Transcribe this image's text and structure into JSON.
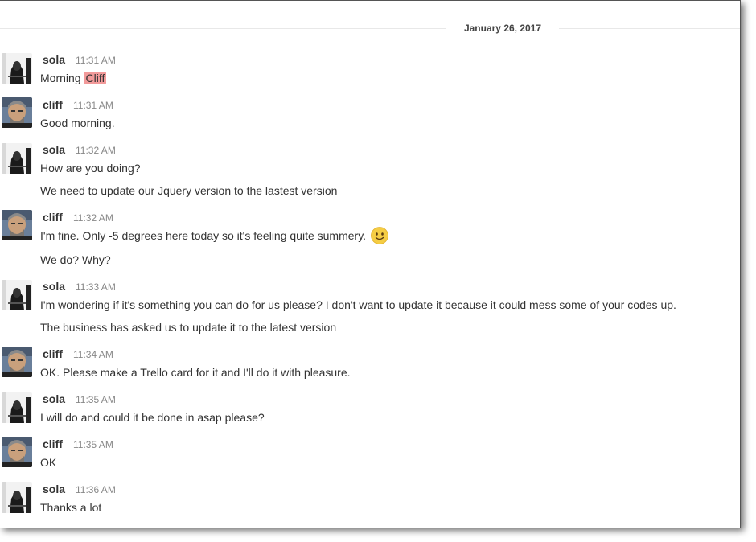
{
  "date_divider": "January 26, 2017",
  "messages": [
    {
      "user": "sola",
      "time": "11:31 AM",
      "lines": [
        {
          "pre": "Morning",
          "mention": "Cliff"
        }
      ]
    },
    {
      "user": "cliff",
      "time": "11:31 AM",
      "lines": [
        "Good morning."
      ]
    },
    {
      "user": "sola",
      "time": "11:32 AM",
      "lines": [
        "How are you doing?",
        "We need to update our Jquery version to the lastest version"
      ]
    },
    {
      "user": "cliff",
      "time": "11:32 AM",
      "lines": [
        "I'm fine. Only -5 degrees here today so it's feeling quite summery.",
        "We do? Why?"
      ]
    },
    {
      "user": "sola",
      "time": "11:33 AM",
      "lines": [
        "I'm wondering if it's something you can do for us please? I don't want to update it because it could mess some of your codes up.",
        "The business has asked us to update it to the latest version"
      ]
    },
    {
      "user": "cliff",
      "time": "11:34 AM",
      "lines": [
        "OK. Please make a Trello card for it and I'll do it with pleasure."
      ]
    },
    {
      "user": "sola",
      "time": "11:35 AM",
      "lines": [
        "I will do and could it be done in asap please?"
      ]
    },
    {
      "user": "cliff",
      "time": "11:35 AM",
      "lines": [
        "OK"
      ]
    },
    {
      "user": "sola",
      "time": "11:36 AM",
      "lines": [
        "Thanks a lot"
      ]
    }
  ],
  "icons": {
    "smile": "slightly-smiling-face-icon"
  },
  "colors": {
    "mention_bg": "#f29a9a",
    "divider_line": "#e8e8e8",
    "timestamp": "#888888"
  }
}
